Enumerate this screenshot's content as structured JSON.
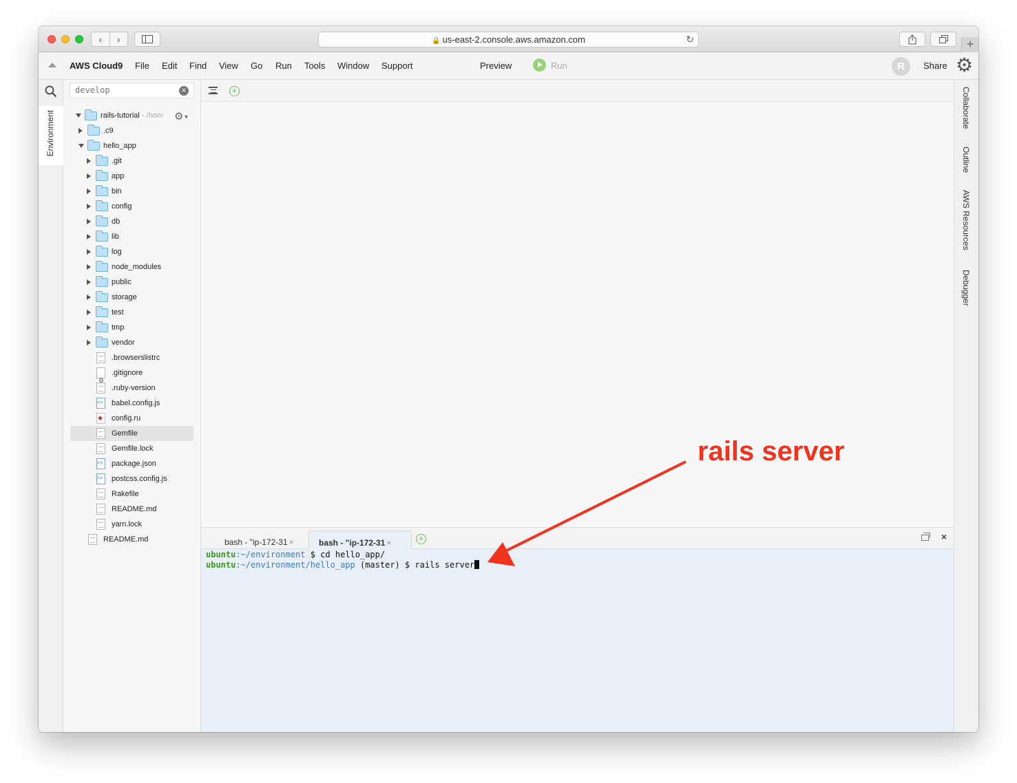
{
  "browser": {
    "url": "us-east-2.console.aws.amazon.com",
    "nav_back_icon": "chevron-left-icon",
    "nav_forward_icon": "chevron-right-icon"
  },
  "menubar": {
    "brand": "AWS Cloud9",
    "items": [
      "File",
      "Edit",
      "Find",
      "View",
      "Go",
      "Run",
      "Tools",
      "Window",
      "Support"
    ],
    "preview": "Preview",
    "run": "Run",
    "avatar_initial": "R",
    "share": "Share"
  },
  "left_rail": {
    "environment_tab": "Environment"
  },
  "tree": {
    "filter_value": "develop",
    "root_name": "rails-tutorial",
    "root_path": " - /hom",
    "rows": [
      {
        "label": ".c9"
      },
      {
        "label": "hello_app"
      },
      {
        "label": ".git"
      },
      {
        "label": "app"
      },
      {
        "label": "bin"
      },
      {
        "label": "config"
      },
      {
        "label": "db"
      },
      {
        "label": "lib"
      },
      {
        "label": "log"
      },
      {
        "label": "node_modules"
      },
      {
        "label": "public"
      },
      {
        "label": "storage"
      },
      {
        "label": "test"
      },
      {
        "label": "tmp"
      },
      {
        "label": "vendor"
      },
      {
        "label": ".browserslistrc"
      },
      {
        "label": ".gitignore"
      },
      {
        "label": ".ruby-version"
      },
      {
        "label": "babel.config.js"
      },
      {
        "label": "config.ru"
      },
      {
        "label": "Gemfile"
      },
      {
        "label": "Gemfile.lock"
      },
      {
        "label": "package.json"
      },
      {
        "label": "postcss.config.js"
      },
      {
        "label": "Rakefile"
      },
      {
        "label": "README.md"
      },
      {
        "label": "yarn.lock"
      },
      {
        "label": "README.md"
      }
    ],
    "selected": "Gemfile"
  },
  "terminal": {
    "tabs": [
      {
        "label": "bash - \"ip-172-31",
        "active": false
      },
      {
        "label": "bash - \"ip-172-31",
        "active": true
      }
    ],
    "close_symbol": "×",
    "panel_close": "×",
    "lines": [
      {
        "user": "ubuntu",
        "path": ":~/environment",
        "rest": " $ cd hello_app/"
      },
      {
        "user": "ubuntu",
        "path": ":~/environment/hello_app",
        "rest": " (master) $ rails server"
      }
    ]
  },
  "right_rail": {
    "tabs": [
      "Collaborate",
      "Outline",
      "AWS Resources",
      "Debugger"
    ]
  },
  "annotation": {
    "text": "rails server",
    "color": "#f2331f"
  }
}
